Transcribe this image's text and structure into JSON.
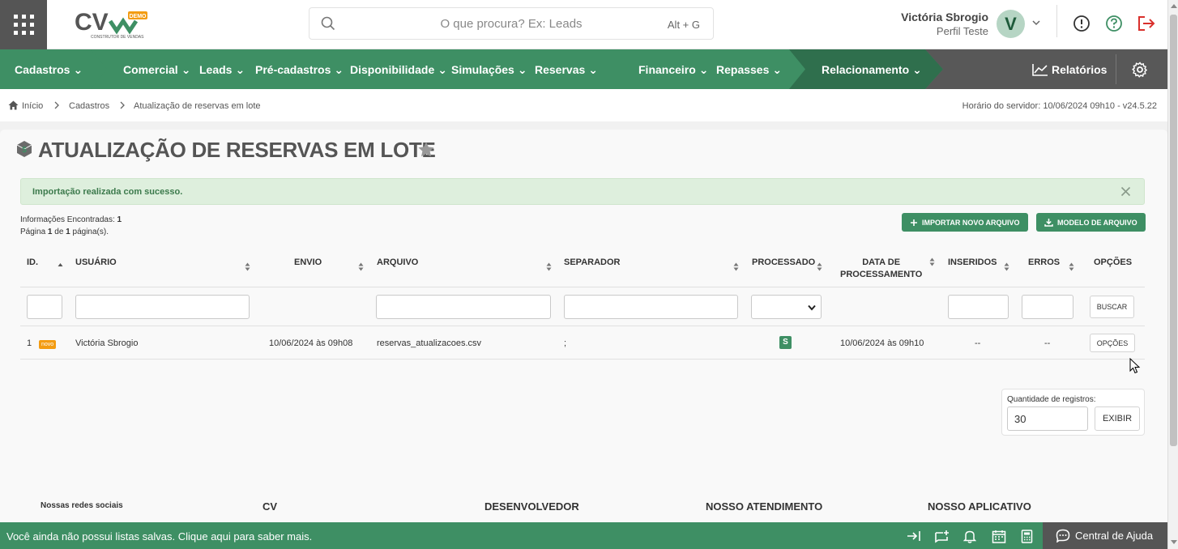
{
  "header": {
    "logo_text": "CV",
    "logo_badge": "DEMO",
    "logo_sub": "CONSTRUTOR DE VENDAS",
    "search_placeholder": "O que procura? Ex: Leads",
    "search_shortcut": "Alt + G",
    "user_name": "Victória Sbrogio",
    "user_role": "Perfil Teste",
    "avatar_initial": "V"
  },
  "nav": {
    "items": [
      "Cadastros",
      "Comercial",
      "Leads",
      "Pré-cadastros",
      "Disponibilidade",
      "Simulações",
      "Reservas",
      "Financeiro",
      "Repasses",
      "Relacionamento"
    ],
    "reports": "Relatórios"
  },
  "breadcrumb": {
    "items": [
      "Início",
      "Cadastros",
      "Atualização de reservas em lote"
    ],
    "server_time": "Horário do servidor: 10/06/2024 09h10 - v24.5.22"
  },
  "page": {
    "title": "ATUALIZAÇÃO DE RESERVAS EM LOTE",
    "alert": "Importação realizada com sucesso.",
    "info_found_label": "Informações Encontradas:",
    "info_found_value": "1",
    "info_page_a": "Página",
    "info_page_num": "1",
    "info_page_b": "de",
    "info_page_total": "1",
    "info_page_c": "página(s).",
    "btn_import": "IMPORTAR NOVO ARQUIVO",
    "btn_model": "MODELO DE ARQUIVO"
  },
  "table": {
    "headers": {
      "id": "ID.",
      "usuario": "USUÁRIO",
      "envio": "ENVIO",
      "arquivo": "ARQUIVO",
      "separador": "SEPARADOR",
      "processado": "PROCESSADO",
      "data_proc_1": "DATA DE",
      "data_proc_2": "PROCESSAMENTO",
      "inseridos": "INSERIDOS",
      "erros": "ERROS",
      "opcoes": "OPÇÕES"
    },
    "search_btn": "BUSCAR",
    "row": {
      "id": "1",
      "badge": "novo",
      "usuario": "Victória Sbrogio",
      "envio": "10/06/2024 às 09h08",
      "arquivo": "reservas_atualizacoes.csv",
      "separador": ";",
      "processado": "S",
      "data_proc": "10/06/2024 às 09h10",
      "inseridos": "--",
      "erros": "--",
      "opcoes": "OPÇÕES"
    }
  },
  "quantity": {
    "label": "Quantidade de registros:",
    "value": "30",
    "btn": "EXIBIR"
  },
  "footer": {
    "social": "Nossas redes sociais",
    "cv": "CV",
    "dev": "DESENVOLVEDOR",
    "atend": "NOSSO ATENDIMENTO",
    "app": "NOSSO APLICATIVO"
  },
  "bottombar": {
    "message": "Você ainda não possui listas salvas. Clique aqui para saber mais.",
    "help": "Central de Ajuda"
  },
  "colors": {
    "primary_green": "#3e8f64",
    "dark_green": "#2f7a55",
    "gray_dark": "#555555",
    "exit_red": "#d9302c",
    "badge_orange": "#f39c12"
  }
}
